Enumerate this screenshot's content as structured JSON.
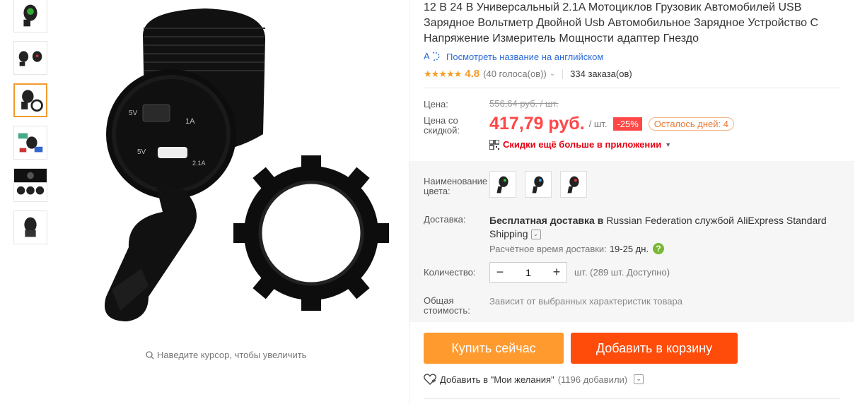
{
  "product": {
    "title": "12 В 24 В Универсальный 2.1A Мотоциклов Грузовик Автомобилей USB Зарядное Вольтметр Двойной Usb Автомобильное Зарядное Устройство С Напряжение Измеритель Мощности адаптер Гнездо",
    "translate_link": "Посмотреть название на английском",
    "rating_value": "4.8",
    "votes": "(40 голоса(ов))",
    "orders": "334 заказа(ов)",
    "stars": "★★★★★"
  },
  "price": {
    "label": "Цена:",
    "old": "556,64 руб. / шт.",
    "discount_label": "Цена со скидкой:",
    "current": "417,79 руб.",
    "per_unit": "/ шт.",
    "discount_badge": "-25%",
    "days_left": "Осталось дней: 4",
    "app_promo": "Скидки ещё больше в приложении"
  },
  "options": {
    "color_label": "Наименование цвета:"
  },
  "shipping": {
    "label": "Доставка:",
    "text_bold": "Бесплатная доставка в",
    "text_rest": "Russian Federation службой AliExpress Standard Shipping",
    "eta_label": "Расчётное время доставки:",
    "eta_value": "19-25 дн."
  },
  "quantity": {
    "label": "Количество:",
    "value": "1",
    "info": "шт. (289 шт. Доступно)"
  },
  "total": {
    "label": "Общая стоимость:",
    "value": "Зависит от выбранных характеристик товара"
  },
  "actions": {
    "buy_now": "Купить сейчас",
    "add_to_cart": "Добавить в корзину",
    "wishlist": "Добавить в \"Мои желания\"",
    "wishlist_count": "(1196 добавили)"
  },
  "gallery": {
    "zoom_hint": "Наведите курсор, чтобы увеличить"
  },
  "colors": {
    "accent_price": "#ff4747",
    "buy_button": "#ff9a2f",
    "cart_button": "#ff4c0a",
    "link": "#2b6cd9",
    "star": "#f59a23"
  },
  "icons": [
    "translate-icon",
    "chevron-down-icon",
    "qr-code-icon",
    "help-icon",
    "heart-icon",
    "magnifier-icon"
  ]
}
